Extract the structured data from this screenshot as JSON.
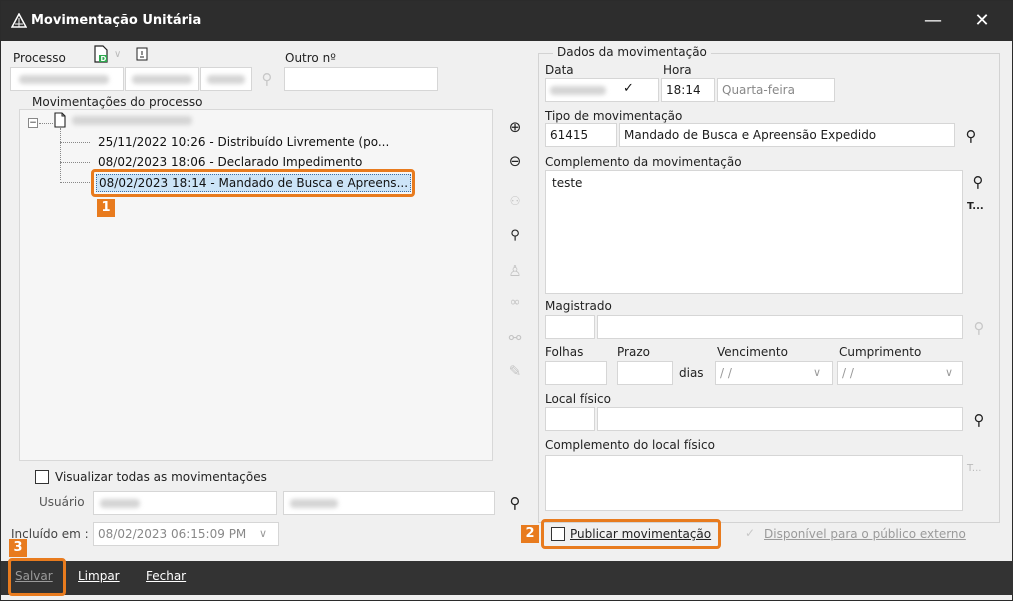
{
  "window": {
    "title": "Movimentação Unitária",
    "minimize": "—",
    "close": "✕"
  },
  "processo": {
    "label": "Processo",
    "outro_label": "Outro nº"
  },
  "movimentacoes": {
    "group_label": "Movimentações do processo",
    "items": [
      "25/11/2022 10:26 - Distribuído Livremente (po...",
      "08/02/2023 18:06 - Declarado Impedimento",
      "08/02/2023 18:14 - Mandado de Busca e Apreens..."
    ],
    "visualizar_todas": "Visualizar todas as movimentações"
  },
  "usuario": {
    "label": "Usuário"
  },
  "incluido": {
    "label": "Incluído em :",
    "value": "08/02/2023 06:15:09 PM"
  },
  "dados": {
    "group_label": "Dados da movimentação",
    "data_label": "Data",
    "hora_label": "Hora",
    "hora_value": "18:14",
    "dia_semana": "Quarta-feira",
    "tipo_label": "Tipo de movimentação",
    "tipo_code": "61415",
    "tipo_desc": "Mandado de Busca e Apreensão Expedido",
    "complemento_label": "Complemento da movimentação",
    "complemento_value": "teste",
    "magistrado_label": "Magistrado",
    "folhas_label": "Folhas",
    "prazo_label": "Prazo",
    "dias_label": "dias",
    "vencimento_label": "Vencimento",
    "vencimento_value": "/ /",
    "cumprimento_label": "Cumprimento",
    "cumprimento_value": "/ /",
    "local_label": "Local físico",
    "complemento_local_label": "Complemento do local físico",
    "publicar_label": "Publicar movimentação",
    "disponivel_label": "Disponível para o público externo",
    "text_btn": "T..."
  },
  "footer": {
    "salvar": "Salvar",
    "limpar": "Limpar",
    "fechar": "Fechar"
  },
  "annotations": {
    "badge1": "1",
    "badge2": "2",
    "badge3": "3"
  },
  "colors": {
    "highlight": "#e87b1e",
    "titlebar": "#2d2d2d",
    "footer": "#333333",
    "selection": "#cce4f7"
  }
}
